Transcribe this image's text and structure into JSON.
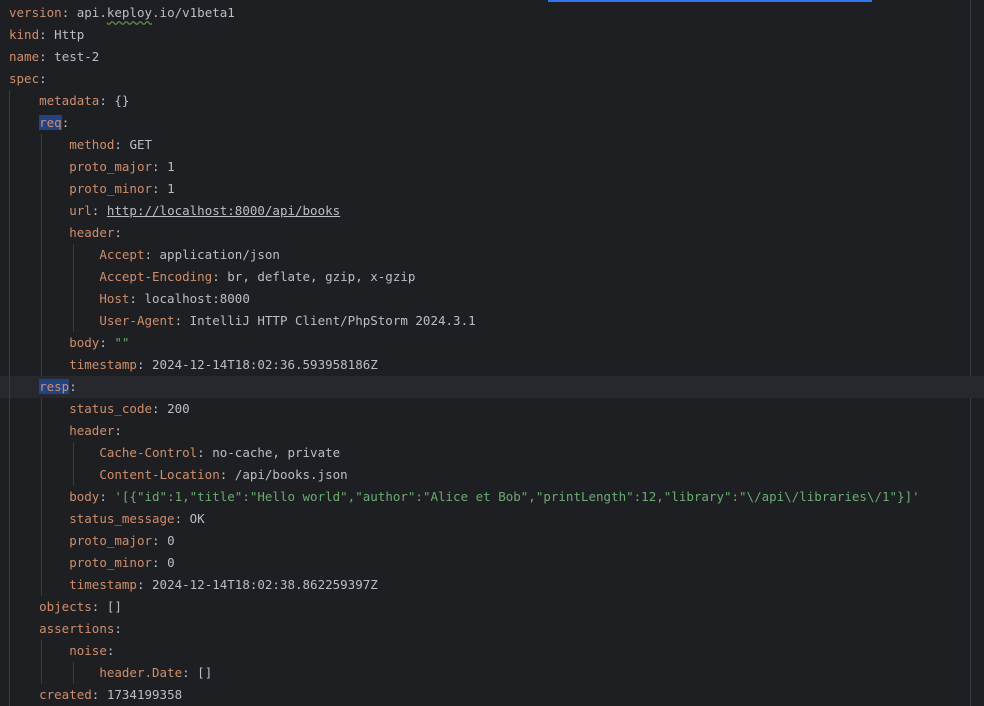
{
  "editor": {
    "doc": {
      "version_key": "version",
      "version_val_a": "api.",
      "version_val_typo": "keploy",
      "version_val_b": ".io/v1beta1",
      "kind_key": "kind",
      "kind_val": "Http",
      "name_key": "name",
      "name_val": "test-2",
      "spec_key": "spec",
      "metadata_key": "metadata",
      "metadata_val": "{}",
      "req_key": "req",
      "req_method_key": "method",
      "req_method_val": "GET",
      "req_proto_major_key": "proto_major",
      "req_proto_major_val": "1",
      "req_proto_minor_key": "proto_minor",
      "req_proto_minor_val": "1",
      "req_url_key": "url",
      "req_url_val": "http://localhost:8000/api/books",
      "req_header_key": "header",
      "accept_key": "Accept",
      "accept_val": "application/json",
      "accept_encoding_key": "Accept-Encoding",
      "accept_encoding_val": "br, deflate, gzip, x-gzip",
      "host_key": "Host",
      "host_val": "localhost:8000",
      "user_agent_key": "User-Agent",
      "user_agent_val": "IntelliJ HTTP Client/PhpStorm 2024.3.1",
      "req_body_key": "body",
      "req_body_val": "\"\"",
      "req_timestamp_key": "timestamp",
      "req_timestamp_val": "2024-12-14T18:02:36.593958186Z",
      "resp_key": "resp",
      "status_code_key": "status_code",
      "status_code_val": "200",
      "resp_header_key": "header",
      "cache_control_key": "Cache-Control",
      "cache_control_val": "no-cache, private",
      "content_location_key": "Content-Location",
      "content_location_val": "/api/books.json",
      "resp_body_key": "body",
      "resp_body_val": "'[{\"id\":1,\"title\":\"Hello world\",\"author\":\"Alice et Bob\",\"printLength\":12,\"library\":\"\\/api\\/libraries\\/1\"}]'",
      "status_message_key": "status_message",
      "status_message_val": "OK",
      "resp_proto_major_key": "proto_major",
      "resp_proto_major_val": "0",
      "resp_proto_minor_key": "proto_minor",
      "resp_proto_minor_val": "0",
      "resp_timestamp_key": "timestamp",
      "resp_timestamp_val": "2024-12-14T18:02:38.862259397Z",
      "objects_key": "objects",
      "objects_val": "[]",
      "assertions_key": "assertions",
      "noise_key": "noise",
      "header_date_key": "header.Date",
      "header_date_val": "[]",
      "created_key": "created",
      "created_val": "1734199358"
    },
    "colors": {
      "background": "#1e1f22",
      "key": "#cf8e6d",
      "value": "#bcbec4",
      "string": "#6aab73",
      "selection": "#214283",
      "current_line": "#26282e",
      "indent_guide": "#393b40",
      "scroll_indicator": "#3574f0"
    }
  }
}
